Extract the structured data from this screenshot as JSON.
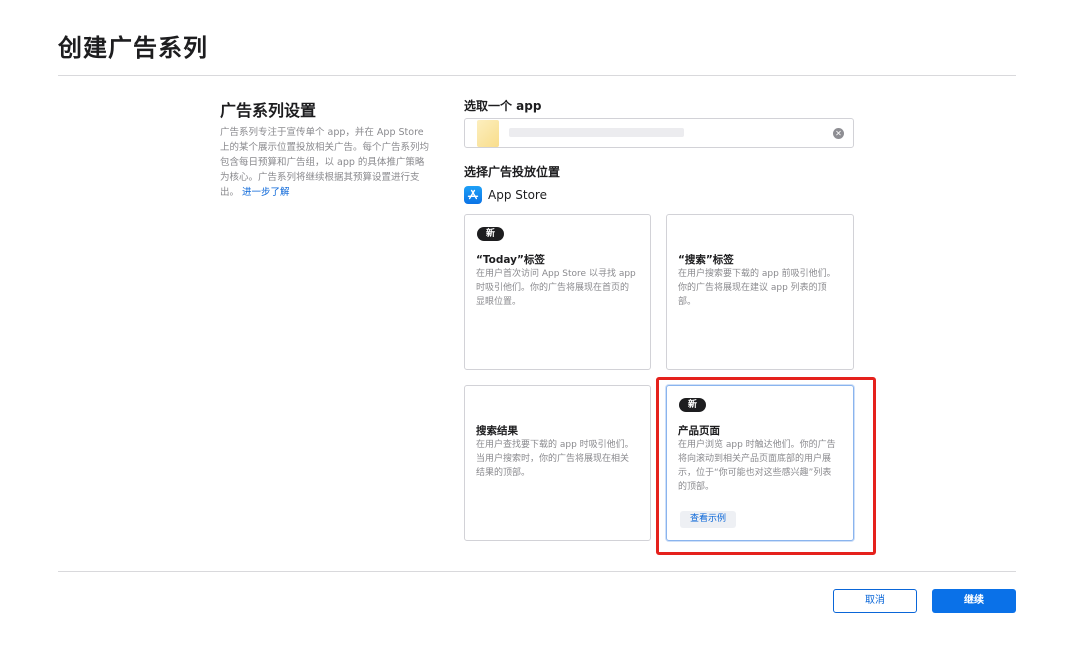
{
  "page": {
    "title": "创建广告系列"
  },
  "settings": {
    "title": "广告系列设置",
    "description": "广告系列专注于宣传单个 app，并在 App Store 上的某个展示位置投放相关广告。每个广告系列均包含每日预算和广告组，以 app 的具体推广策略为核心。广告系列将继续根据其预算设置进行支出。",
    "learn_more": "进一步了解"
  },
  "app_select": {
    "label": "选取一个 app",
    "value": ""
  },
  "placement": {
    "label": "选择广告投放位置",
    "store_name": "App Store",
    "cards": [
      {
        "badge": "新",
        "title": "“Today”标签",
        "description": "在用户首次访问 App Store 以寻找 app 时吸引他们。你的广告将展现在首页的显眼位置。"
      },
      {
        "title": "“搜索”标签",
        "description": "在用户搜索要下载的 app 前吸引他们。你的广告将展现在建议 app 列表的顶部。"
      },
      {
        "title": "搜索结果",
        "description": "在用户查找要下载的 app 时吸引他们。当用户搜索时，你的广告将展现在相关结果的顶部。"
      },
      {
        "badge": "新",
        "title": "产品页面",
        "description": "在用户浏览 app 时触达他们。你的广告将向滚动到相关产品页面底部的用户展示，位于“你可能也对这些感兴趣”列表的顶部。",
        "example_label": "查看示例"
      }
    ]
  },
  "footer": {
    "cancel_label": "取消",
    "continue_label": "继续"
  },
  "colors": {
    "accent": "#0a71e8",
    "highlight": "#e5211c"
  }
}
